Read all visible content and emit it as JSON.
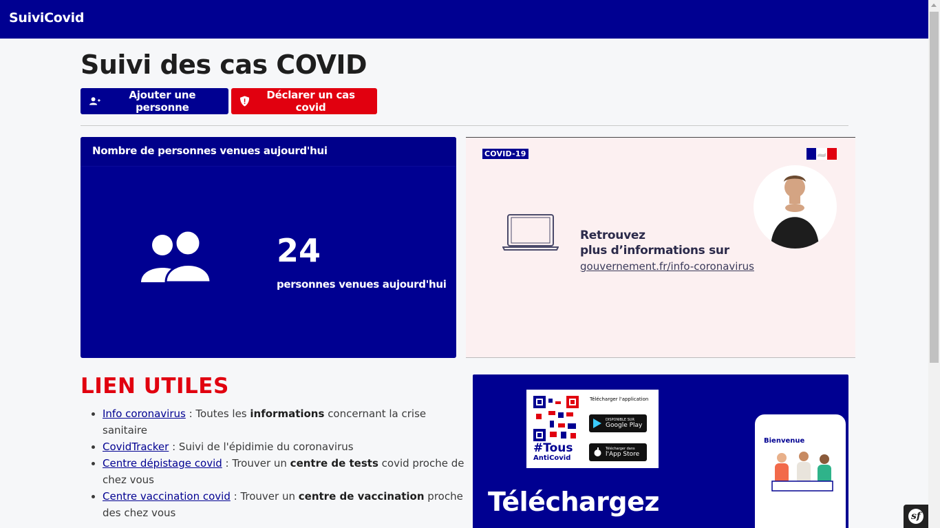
{
  "navbar": {
    "brand": "SuiviCovid"
  },
  "page": {
    "title": "Suivi des cas COVID"
  },
  "actions": {
    "add_person": "Ajouter une personne",
    "declare_case": "Déclarer un cas covid"
  },
  "count_card": {
    "header": "Nombre de personnes venues aujourd'hui",
    "value": "24",
    "label": "personnes venues aujourd'hui",
    "icon": "users-icon"
  },
  "info_banner": {
    "badge": "COVID-19",
    "line1": "Retrouvez",
    "line2": "plus d’informations sur",
    "link": "gouvernement.fr/info-coronavirus"
  },
  "useful_links": {
    "title": "LIEN UTILES",
    "items": [
      {
        "link": "Info coronavirus",
        "pre": " : Toutes les ",
        "bold": "informations",
        "post": " concernant la crise sanitaire"
      },
      {
        "link": "CovidTracker",
        "pre": " : Suivi de l'épidimie du coronavirus",
        "bold": "",
        "post": ""
      },
      {
        "link": "Centre dépistage covid",
        "pre": " : Trouver un ",
        "bold": "centre de tests",
        "post": " covid proche de chez vous"
      },
      {
        "link": "Centre vaccination covid",
        "pre": " : Trouver un ",
        "bold": "centre de vaccination",
        "post": " proche des chez vous"
      }
    ]
  },
  "app_banner": {
    "download_label": "Télécharger l'application",
    "google_play_small": "DISPONIBLE SUR",
    "google_play": "Google Play",
    "app_store_small": "Télécharger dans",
    "app_store": "l'App Store",
    "tous": "#Tous",
    "anticovid": "AntiCovid",
    "phone_welcome": "Bienvenue",
    "headline": "Téléchargez"
  },
  "colors": {
    "primary": "#000091",
    "danger": "#e1000f",
    "background": "#f6f7f9"
  }
}
